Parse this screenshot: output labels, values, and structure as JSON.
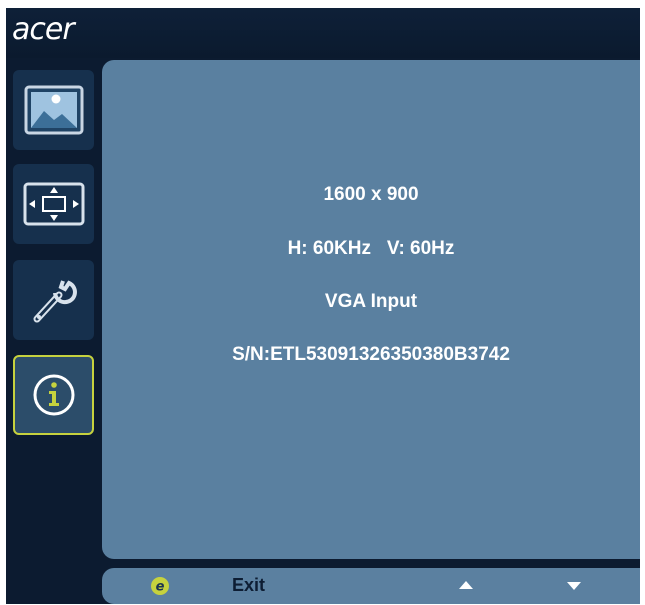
{
  "header": {
    "brand": "acer"
  },
  "sidebar": {
    "items": [
      {
        "name": "picture",
        "icon": "picture-icon",
        "active": false
      },
      {
        "name": "position",
        "icon": "screen-position-icon",
        "active": false
      },
      {
        "name": "settings",
        "icon": "wrench-icon",
        "active": false
      },
      {
        "name": "information",
        "icon": "info-icon",
        "active": true
      }
    ]
  },
  "info": {
    "resolution": "1600 x 900",
    "frequency": "H: 60KHz   V: 60Hz",
    "input": "VGA Input",
    "serial": "S/N:ETL53091326350380B3742"
  },
  "footer": {
    "exit_icon": "e-exit-icon",
    "exit_label": "Exit",
    "up_icon": "arrow-up-icon",
    "down_icon": "arrow-down-icon"
  },
  "colors": {
    "accent": "#c6d23e",
    "panel": "#5a80a0",
    "background": "#0c1b30"
  }
}
